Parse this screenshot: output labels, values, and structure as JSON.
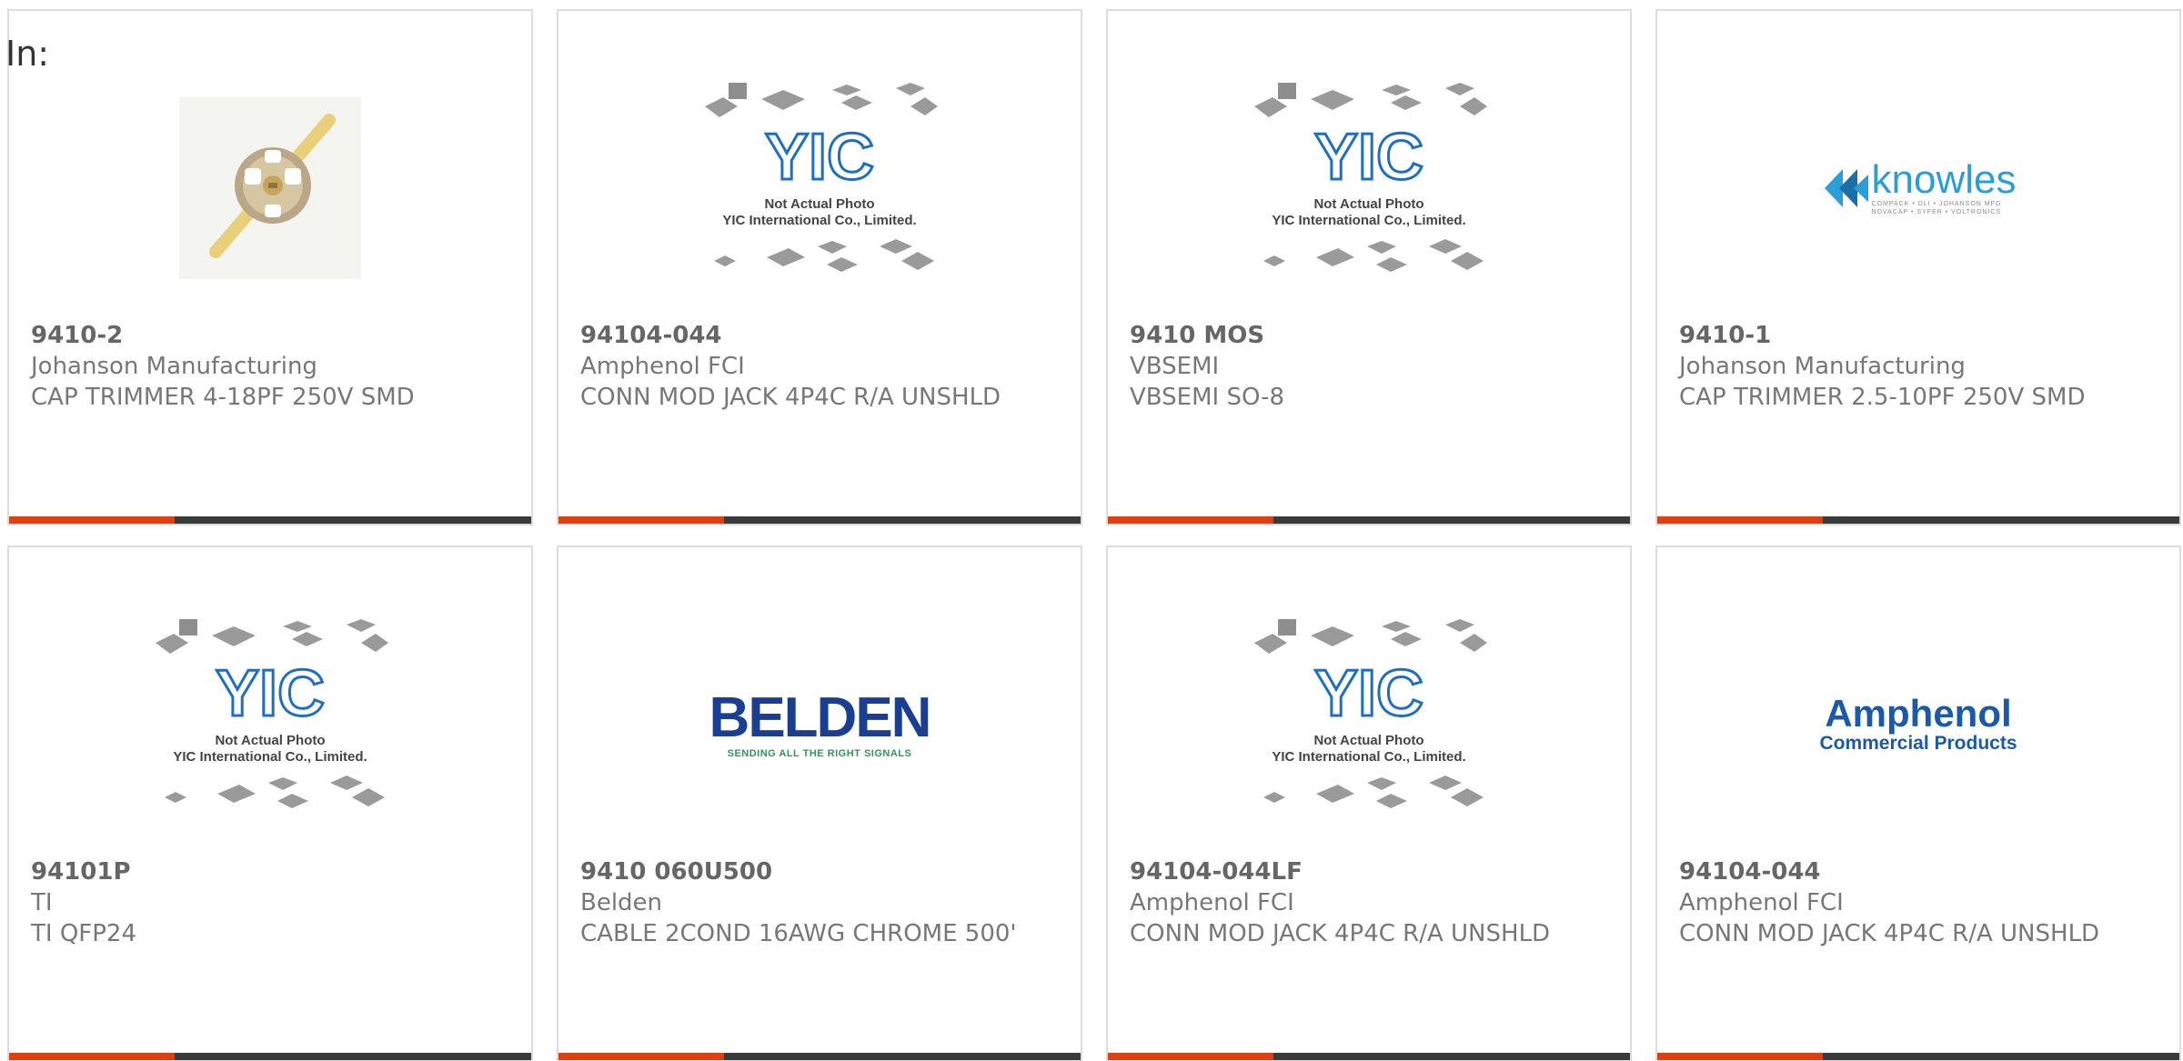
{
  "header": {
    "label": "In:"
  },
  "colors": {
    "accent": "#e03e0f",
    "bar": "#3a3a3a",
    "text": "#777777",
    "border": "#dddddd"
  },
  "products": [
    {
      "part": "9410-2",
      "manufacturer": "Johanson Manufacturing",
      "description": "CAP TRIMMER 4-18PF 250V SMD",
      "image": "trimmer-capacitor-photo"
    },
    {
      "part": "94104-044",
      "manufacturer": "Amphenol FCI",
      "description": "CONN MOD JACK 4P4C R/A UNSHLD",
      "image": "yic-placeholder",
      "image_caption_1": "Not Actual Photo",
      "image_caption_2": "YIC International Co., Limited."
    },
    {
      "part": "9410 MOS",
      "manufacturer": "VBSEMI",
      "description": "VBSEMI SO-8",
      "image": "yic-placeholder",
      "image_caption_1": "Not Actual Photo",
      "image_caption_2": "YIC International Co., Limited."
    },
    {
      "part": "9410-1",
      "manufacturer": "Johanson Manufacturing",
      "description": "CAP TRIMMER 2.5-10PF 250V SMD",
      "image": "knowles-logo"
    },
    {
      "part": "94101P",
      "manufacturer": "TI",
      "description": "TI QFP24",
      "image": "yic-placeholder",
      "image_caption_1": "Not Actual Photo",
      "image_caption_2": "YIC International Co., Limited."
    },
    {
      "part": "9410 060U500",
      "manufacturer": "Belden",
      "description": "CABLE 2COND 16AWG CHROME 500'",
      "image": "belden-logo"
    },
    {
      "part": "94104-044LF",
      "manufacturer": "Amphenol FCI",
      "description": "CONN MOD JACK 4P4C R/A UNSHLD",
      "image": "yic-placeholder",
      "image_caption_1": "Not Actual Photo",
      "image_caption_2": "YIC International Co., Limited."
    },
    {
      "part": "94104-044",
      "manufacturer": "Amphenol FCI",
      "description": "CONN MOD JACK 4P4C R/A UNSHLD",
      "image": "amphenol-logo"
    }
  ],
  "logos": {
    "knowles_word": "knowles",
    "knowles_sub_1": "COMPACK • DLI • JOHANSON MFG",
    "knowles_sub_2": "NOVACAP • SYFER • VOLTRONICS",
    "belden_word": "BELDEN",
    "belden_tag": "SENDING ALL THE RIGHT SIGNALS",
    "amphenol_word": "Amphenol",
    "amphenol_sub": "Commercial Products"
  }
}
